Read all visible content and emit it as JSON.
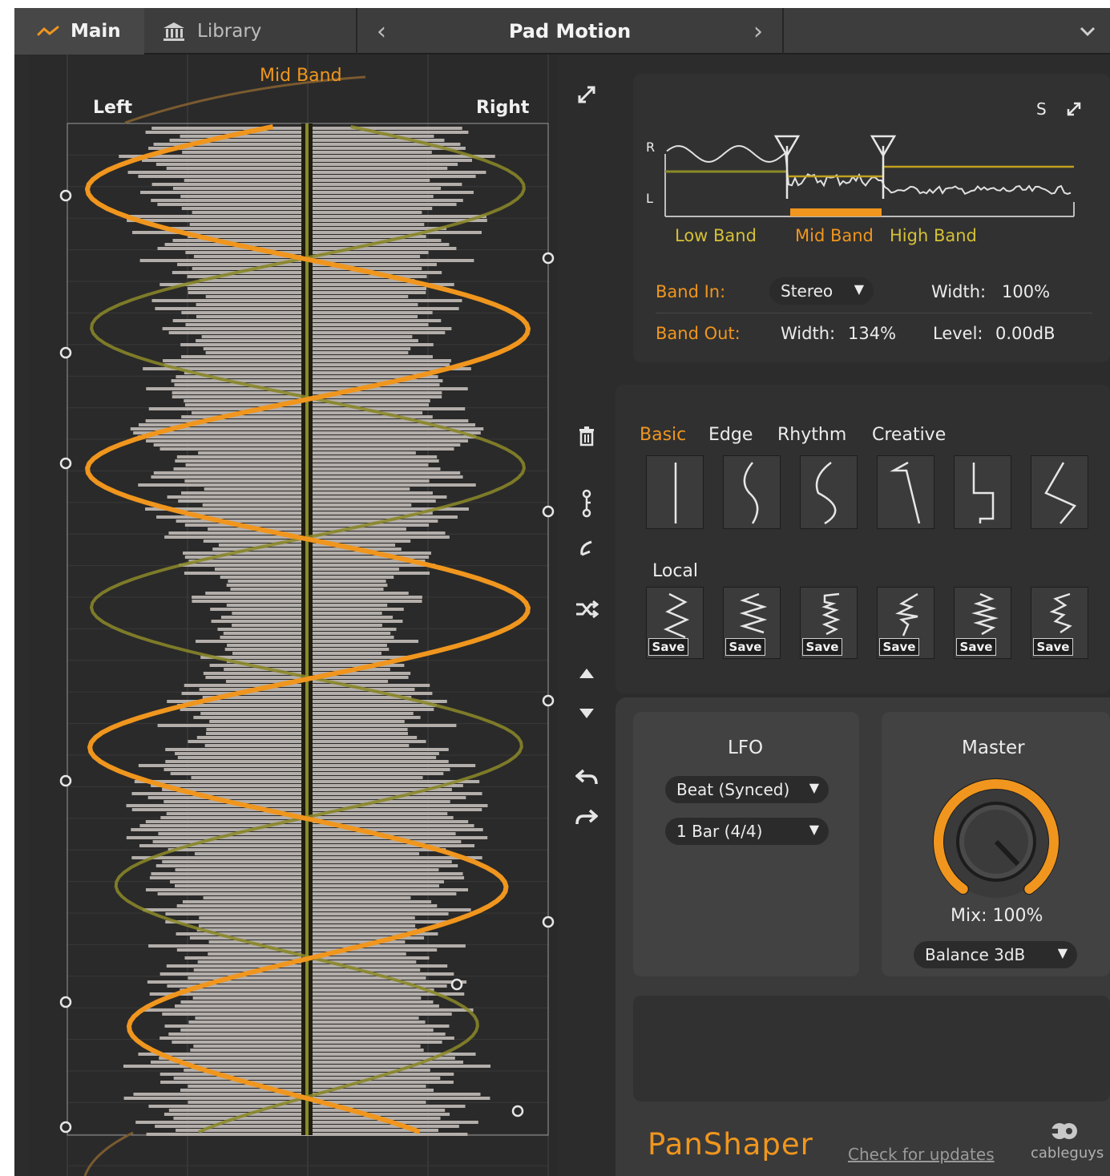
{
  "topbar": {
    "tab_main": "Main",
    "tab_library": "Library",
    "preset_name": "Pad Motion"
  },
  "editor": {
    "band_label": "Mid Band",
    "left_label": "Left",
    "right_label": "Right"
  },
  "band_display": {
    "solo_label": "S",
    "r_label": "R",
    "l_label": "L",
    "bands": [
      "Low Band",
      "Mid Band",
      "High Band"
    ],
    "band_in_label": "Band In:",
    "band_in_value": "Stereo",
    "width_in_label": "Width:",
    "width_in_value": "100%",
    "band_out_label": "Band Out:",
    "width_out_label": "Width:",
    "width_out_value": "134%",
    "level_label": "Level:",
    "level_value": "0.00dB"
  },
  "shapes": {
    "tabs": [
      "Basic",
      "Edge",
      "Rhythm",
      "Creative"
    ],
    "active_tab": "Basic",
    "local_label": "Local",
    "save_label": "Save"
  },
  "lfo": {
    "title": "LFO",
    "mode": "Beat (Synced)",
    "rate": "1 Bar (4/4)"
  },
  "master": {
    "title": "Master",
    "mix_label": "Mix: 100%",
    "balance": "Balance 3dB"
  },
  "footer": {
    "brand": "PanShaper",
    "update_link": "Check for updates",
    "vendor": "cableguys"
  },
  "colors": {
    "accent_orange": "#f0961e",
    "band_yellow": "#d4c038",
    "olive_curve": "#8c8a28"
  }
}
